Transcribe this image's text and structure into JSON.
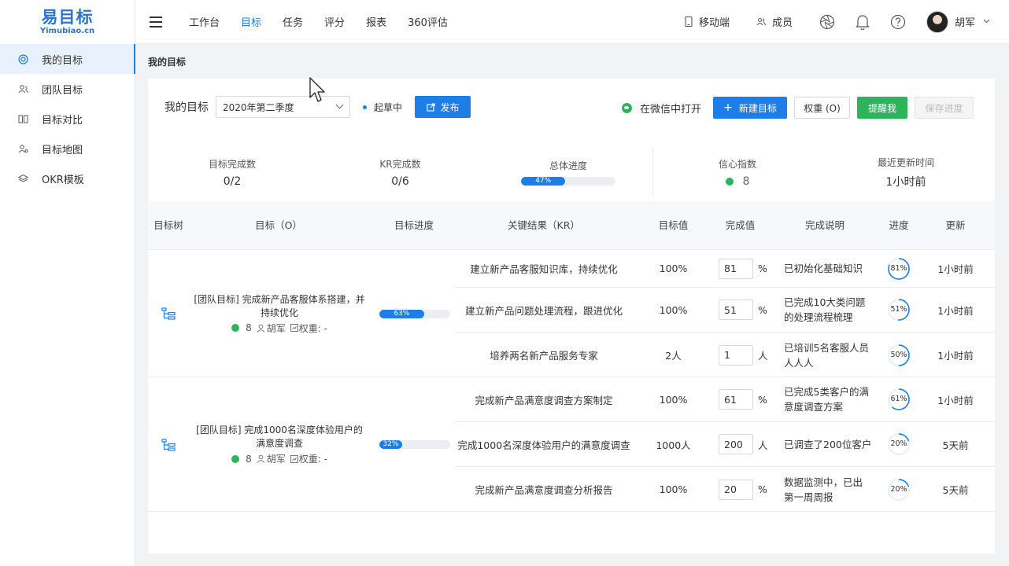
{
  "app": {
    "logo": "易目标",
    "logo_sub": "Yimubiao.cn"
  },
  "sidebar": {
    "items": [
      {
        "label": "我的目标",
        "icon": "target-icon",
        "active": true
      },
      {
        "label": "团队目标",
        "icon": "team-icon",
        "active": false
      },
      {
        "label": "目标对比",
        "icon": "compare-icon",
        "active": false
      },
      {
        "label": "目标地图",
        "icon": "map-icon",
        "active": false
      },
      {
        "label": "OKR模板",
        "icon": "layers-icon",
        "active": false
      }
    ]
  },
  "topnav": {
    "items": [
      "工作台",
      "目标",
      "任务",
      "评分",
      "报表",
      "360评估"
    ],
    "active_index": 1,
    "mobile_label": "移动端",
    "members_label": "成员",
    "user_name": "胡军"
  },
  "breadcrumb": {
    "title": "我的目标"
  },
  "toolbar": {
    "label": "我的目标",
    "period": "2020年第二季度",
    "status": "起草中",
    "publish_label": "发布",
    "wechat_label": "在微信中打开",
    "new_label": "新建目标",
    "weight_label": "权重 (O)",
    "remind_label": "提醒我",
    "save_label": "保存进度"
  },
  "stats": {
    "objectives_done_label": "目标完成数",
    "objectives_done": "0/2",
    "kr_done_label": "KR完成数",
    "kr_done": "0/6",
    "overall_label": "总体进度",
    "overall_text": "47%",
    "overall_value": 47,
    "confidence_label": "信心指数",
    "confidence": "8",
    "updated_label": "最近更新时间",
    "updated": "1小时前"
  },
  "table": {
    "headers": [
      "目标树",
      "目标（O）",
      "目标进度",
      "关键结果（KR）",
      "目标值",
      "完成值",
      "完成说明",
      "进度",
      "更新"
    ],
    "objectives": [
      {
        "title": "[团队目标] 完成新产品客服体系搭建，并持续优化",
        "confidence": "8",
        "owner": "胡军",
        "weight": "权重: -",
        "progress_text": "63%",
        "progress": 63,
        "krs": [
          {
            "name": "建立新产品客服知识库，持续优化",
            "target": "100%",
            "done": "81",
            "unit": "%",
            "desc": "已初始化基础知识",
            "progress_text": "81%",
            "progress": 81,
            "updated": "1小时前"
          },
          {
            "name": "建立新产品问题处理流程，跟进优化",
            "target": "100%",
            "done": "51",
            "unit": "%",
            "desc": "已完成10大类问题的处理流程梳理",
            "progress_text": "51%",
            "progress": 51,
            "updated": "1小时前"
          },
          {
            "name": "培养两名新产品服务专家",
            "target": "2人",
            "done": "1",
            "unit": "人",
            "desc": "已培训5名客服人员人人人",
            "progress_text": "50%",
            "progress": 50,
            "updated": "1小时前"
          }
        ]
      },
      {
        "title": "[团队目标] 完成1000名深度体验用户的满意度调查",
        "confidence": "8",
        "owner": "胡军",
        "weight": "权重: -",
        "progress_text": "32%",
        "progress": 32,
        "krs": [
          {
            "name": "完成新产品满意度调查方案制定",
            "target": "100%",
            "done": "61",
            "unit": "%",
            "desc": "已完成5类客户的满意度调查方案",
            "progress_text": "61%",
            "progress": 61,
            "updated": "1小时前"
          },
          {
            "name": "完成1000名深度体验用户的满意度调查",
            "target": "1000人",
            "done": "200",
            "unit": "人",
            "desc": "已调查了200位客户",
            "progress_text": "20%",
            "progress": 20,
            "updated": "5天前"
          },
          {
            "name": "完成新产品满意度调查分析报告",
            "target": "100%",
            "done": "20",
            "unit": "%",
            "desc": "数据监测中，已出第一周周报",
            "progress_text": "20%",
            "progress": 20,
            "updated": "5天前"
          }
        ]
      }
    ]
  },
  "colors": {
    "primary": "#1e7ee6",
    "green": "#2eb35a",
    "ring_track": "#e6ecf3"
  }
}
